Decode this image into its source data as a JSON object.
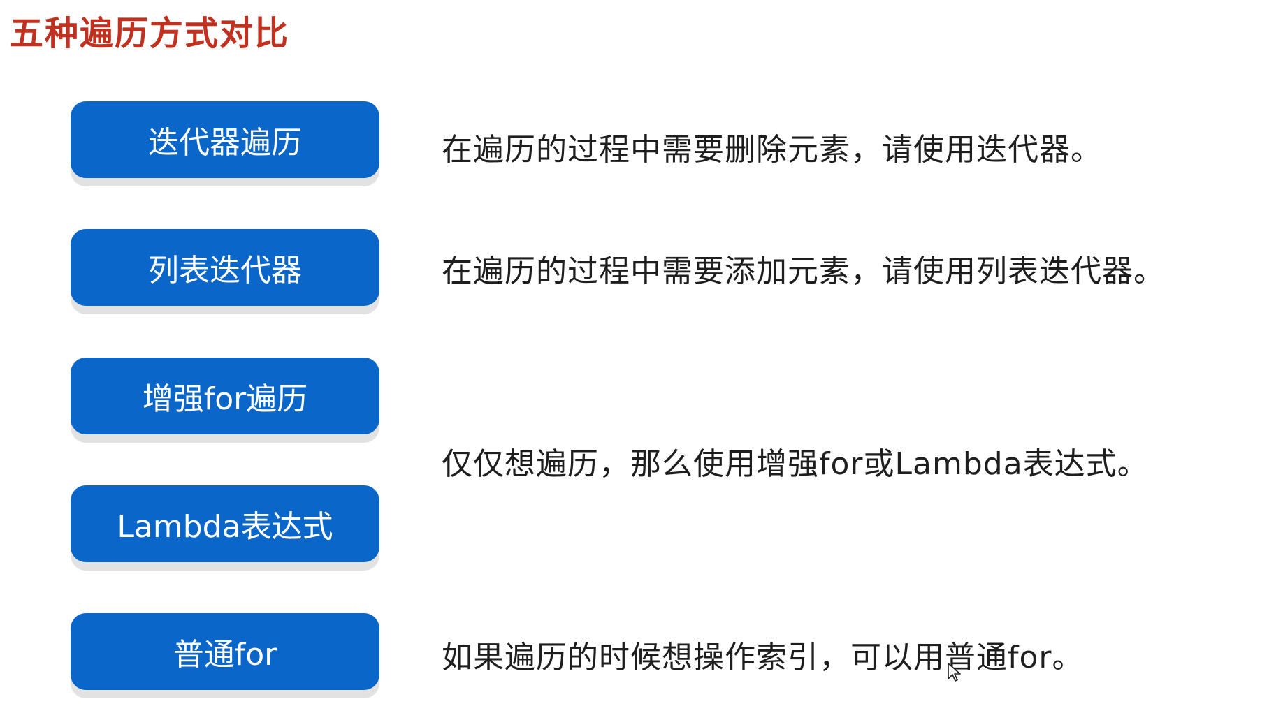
{
  "title": "五种遍历方式对比",
  "buttons": [
    {
      "label": "迭代器遍历"
    },
    {
      "label": "列表迭代器"
    },
    {
      "label": "增强for遍历"
    },
    {
      "label": "Lambda表达式"
    },
    {
      "label": "普通for"
    }
  ],
  "descriptions": [
    {
      "text": "在遍历的过程中需要删除元素，请使用迭代器。"
    },
    {
      "text": "在遍历的过程中需要添加元素，请使用列表迭代器。"
    },
    {
      "text": "仅仅想遍历，那么使用增强for或Lambda表达式。"
    },
    {
      "text": "如果遍历的时候想操作索引，可以用普通for。"
    }
  ],
  "colors": {
    "title": "#c0311f",
    "button_bg": "#0a66c8",
    "button_text": "#ffffff",
    "text": "#1e1e1e"
  },
  "icons": {
    "cursor": "mouse-pointer-icon"
  }
}
